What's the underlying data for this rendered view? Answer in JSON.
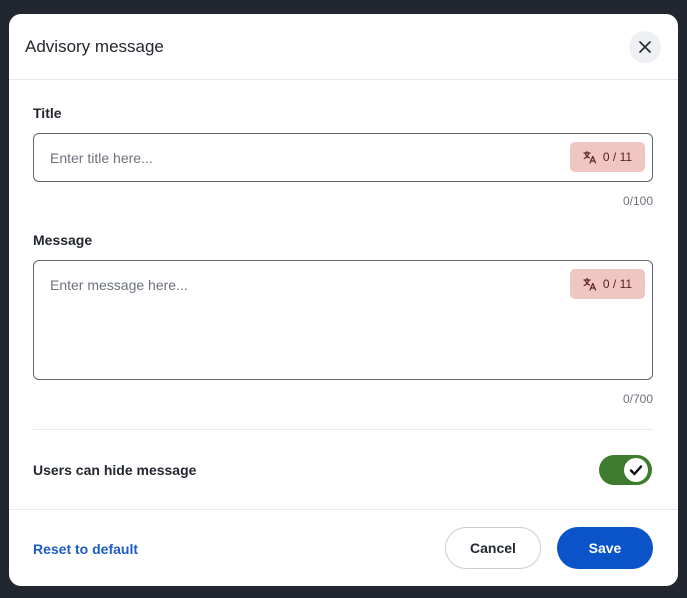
{
  "dialog": {
    "title": "Advisory message",
    "close_icon": "close-icon"
  },
  "title_field": {
    "label": "Title",
    "value": "",
    "placeholder": "Enter title here...",
    "translation_badge": "0 / 11",
    "badge_icon": "translate-icon",
    "counter": "0/100"
  },
  "message_field": {
    "label": "Message",
    "value": "",
    "placeholder": "Enter message here...",
    "translation_badge": "0 / 11",
    "badge_icon": "translate-icon",
    "counter": "0/700"
  },
  "hide_toggle": {
    "label": "Users can hide message",
    "checked": true,
    "color": "#3d7b2d"
  },
  "footer": {
    "reset_label": "Reset to default",
    "cancel_label": "Cancel",
    "save_label": "Save"
  },
  "colors": {
    "accent": "#0a53c8",
    "link": "#1e5cc6",
    "badge_bg": "#f0c6c3"
  }
}
